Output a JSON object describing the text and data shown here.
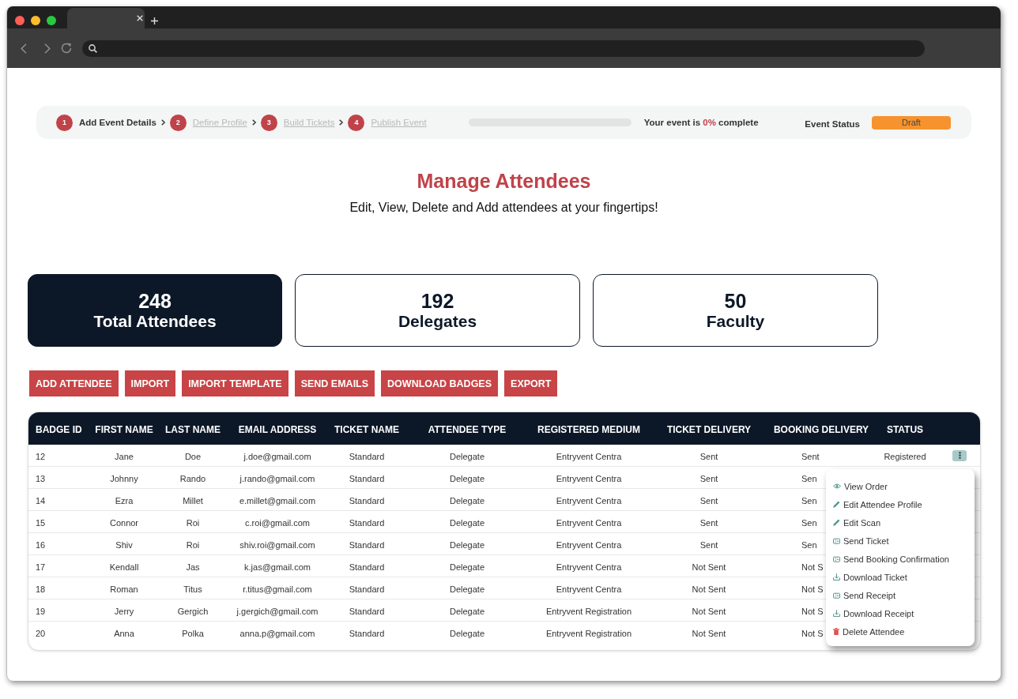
{
  "stepper": {
    "steps": [
      {
        "number": "1",
        "label": "Add Event Details",
        "current": true
      },
      {
        "number": "2",
        "label": "Define Profile",
        "current": false
      },
      {
        "number": "3",
        "label": "Build Tickets",
        "current": false
      },
      {
        "number": "4",
        "label": "Publish Event",
        "current": false
      }
    ],
    "progress": {
      "level": 0,
      "text": "Your event is **0%** complete"
    },
    "event_status": {
      "label": "Event Status",
      "value": "Draft"
    }
  },
  "header": {
    "title": "Manage Attendees",
    "subtitle": "Edit, View, Delete and Add attendees at your fingertips!"
  },
  "stats": [
    {
      "value": "248",
      "label": "Total Attendees",
      "selected": true
    },
    {
      "value": "192",
      "label": "Delegates",
      "selected": false
    },
    {
      "value": "50",
      "label": "Faculty",
      "selected": false
    }
  ],
  "actions": [
    "ADD ATTENDEE",
    "IMPORT",
    "IMPORT TEMPLATE",
    "SEND EMAILS",
    "DOWNLOAD BADGES",
    "EXPORT"
  ],
  "table": {
    "columns": [
      "BADGE ID",
      "FIRST NAME",
      "LAST NAME",
      "EMAIL ADDRESS",
      "TICKET NAME",
      "ATTENDEE TYPE",
      "REGISTERED MEDIUM",
      "TICKET DELIVERY",
      "BOOKING DELIVERY",
      "STATUS"
    ],
    "rows": [
      {
        "cells": [
          "12",
          "Jane",
          "Doe",
          "j.doe@gmail.com",
          "Standard",
          "Delegate",
          "Entryvent Centra",
          "Sent",
          "Sent",
          "Registered"
        ],
        "menu": {
          "items": [
            {
              "kind": "view",
              "label": "View Order"
            },
            {
              "kind": "edit",
              "label": "Edit Attendee Profile"
            },
            {
              "kind": "edit",
              "label": "Edit Scan"
            },
            {
              "kind": "send",
              "label": "Send Ticket"
            },
            {
              "kind": "send",
              "label": "Send Booking Confirmation"
            },
            {
              "kind": "download",
              "label": "Download Ticket"
            },
            {
              "kind": "send",
              "label": "Send Receipt"
            },
            {
              "kind": "download",
              "label": "Download Receipt"
            },
            {
              "kind": "delete",
              "label": "Delete Attendee"
            }
          ]
        }
      },
      {
        "cells": [
          "13",
          "Johnny",
          "Rando",
          "j.rando@gmail.com",
          "Standard",
          "Delegate",
          "Entryvent Centra",
          "Sent",
          "Sen"
        ]
      },
      {
        "cells": [
          "14",
          "Ezra",
          "Millet",
          "e.millet@gmail.com",
          "Standard",
          "Delegate",
          "Entryvent Centra",
          "Sent",
          "Sen"
        ]
      },
      {
        "cells": [
          "15",
          "Connor",
          "Roi",
          "c.roi@gmail.com",
          "Standard",
          "Delegate",
          "Entryvent Centra",
          "Sent",
          "Sen"
        ]
      },
      {
        "cells": [
          "16",
          "Shiv",
          "Roi",
          "shiv.roi@gmail.com",
          "Standard",
          "Delegate",
          "Entryvent Centra",
          "Sent",
          "Sen"
        ]
      },
      {
        "cells": [
          "17",
          "Kendall",
          "Jas",
          "k.jas@gmail.com",
          "Standard",
          "Delegate",
          "Entryvent Centra",
          "Not Sent",
          "Not S"
        ]
      },
      {
        "cells": [
          "18",
          "Roman",
          "Titus",
          "r.titus@gmail.com",
          "Standard",
          "Delegate",
          "Entryvent Centra",
          "Not Sent",
          "Not S"
        ]
      },
      {
        "cells": [
          "19",
          "Jerry",
          "Gergich",
          "j.gergich@gmail.com",
          "Standard",
          "Delegate",
          "Entryvent Registration",
          "Not Sent",
          "Not S"
        ]
      },
      {
        "cells": [
          "20",
          "Anna",
          "Polka",
          "anna.p@gmail.com",
          "Standard",
          "Delegate",
          "Entryvent Registration",
          "Not Sent",
          "Not S"
        ]
      }
    ]
  }
}
